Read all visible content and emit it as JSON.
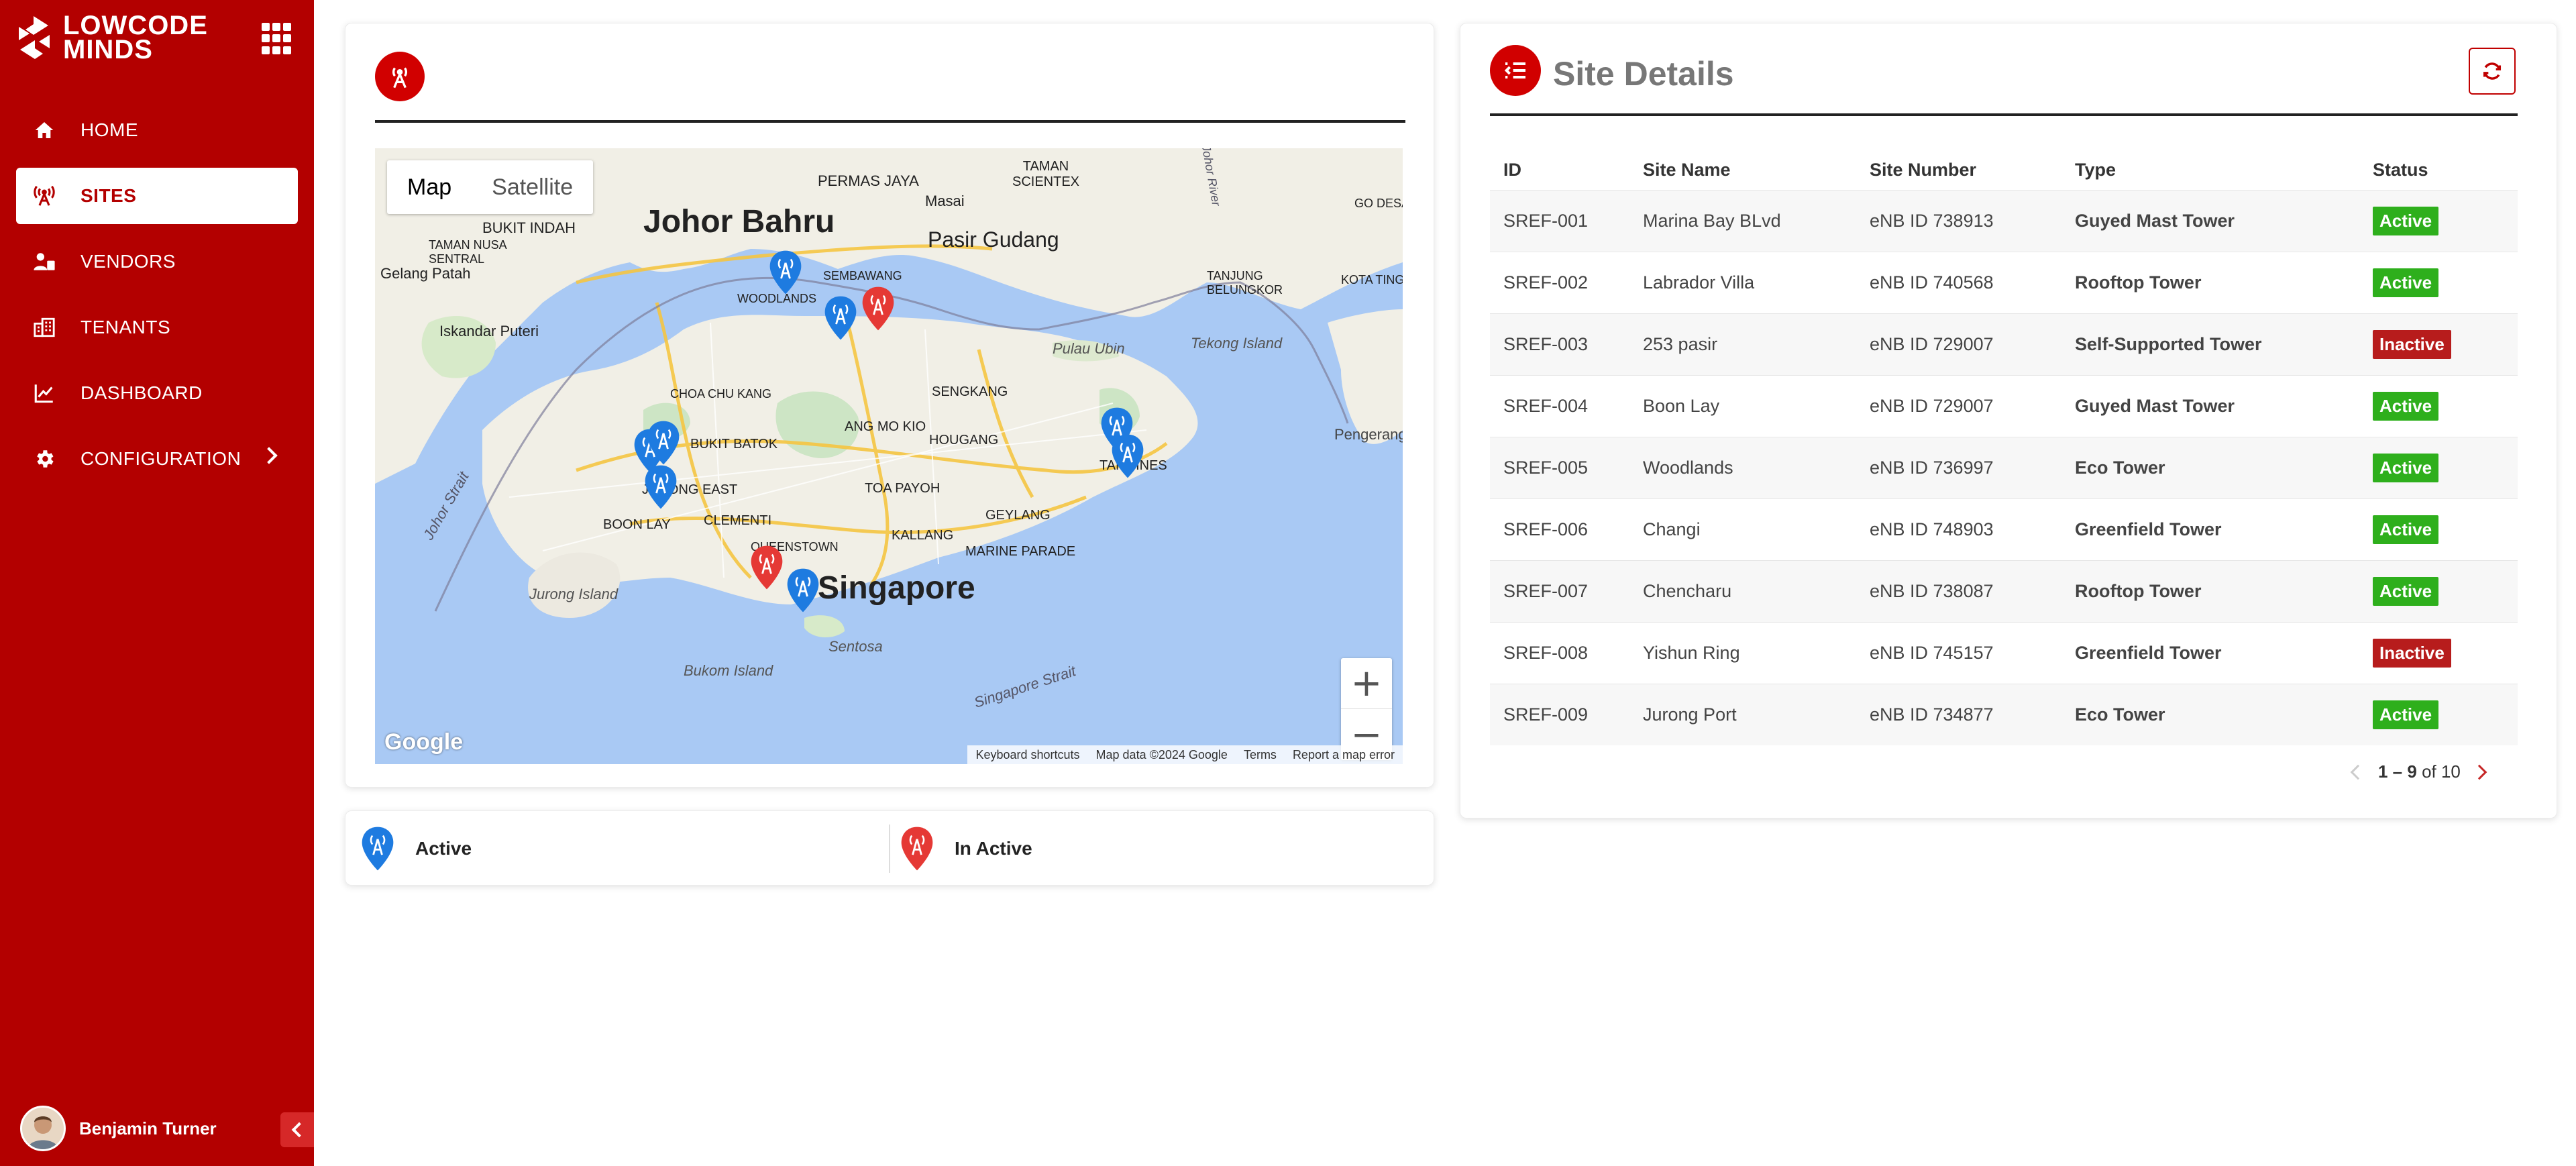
{
  "brand": {
    "name": "LOWCODE MINDS"
  },
  "sidebar": {
    "items": [
      {
        "label": "HOME",
        "icon": "home-icon"
      },
      {
        "label": "SITES",
        "icon": "antenna-icon",
        "active": true
      },
      {
        "label": "VENDORS",
        "icon": "vendor-icon"
      },
      {
        "label": "TENANTS",
        "icon": "building-icon"
      },
      {
        "label": "DASHBOARD",
        "icon": "chart-icon"
      },
      {
        "label": "CONFIGURATION",
        "icon": "gear-icon"
      }
    ],
    "user": {
      "name": "Benjamin Turner"
    }
  },
  "map": {
    "tabs": [
      "Map",
      "Satellite"
    ],
    "zoom_in": "+",
    "zoom_out": "−",
    "logo": "Google",
    "footer": [
      "Keyboard shortcuts",
      "Map data ©2024 Google",
      "Terms",
      "Report a map error"
    ],
    "labels": {
      "johor_bahru": "Johor Bahru",
      "singapore": "Singapore",
      "pasir_gudang": "Pasir Gudang",
      "jurong_island": "Jurong Island",
      "bukom_island": "Bukom Island",
      "sentosa": "Sentosa",
      "pulau_ubin": "Pulau Ubin",
      "tekong_island": "Tekong Island",
      "pengerang": "Pengerang",
      "iskandar_puteri": "Iskandar Puteri",
      "gelang_patah": "Gelang Patah",
      "bukit_indah": "BUKIT INDAH",
      "permas_jaya": "PERMAS JAYA",
      "masai": "Masai",
      "taman_scientex": "TAMAN SCIENTEX",
      "taman_nusa_sentral": "TAMAN NUSA SENTRAL",
      "sembawang": "SEMBAWANG",
      "woodlands": "WOODLANDS",
      "choa_chu_kang": "CHOA CHU KANG",
      "bukit_batok": "BUKIT BATOK",
      "ang_mo_kio": "ANG MO KIO",
      "sengkang": "SENGKANG",
      "hougang": "HOUGANG",
      "toa_payoh": "TOA PAYOH",
      "tampines": "TAMPINES",
      "geylang": "GEYLANG",
      "kallang": "KALLANG",
      "marine_parade": "MARINE PARADE",
      "queenstown": "QUEENSTOWN",
      "clementi": "CLEMENTI",
      "jurong_east": "JURONG EAST",
      "boon_lay": "BOON LAY",
      "johor_strait": "Johor Strait",
      "singapore_strait": "Singapore Strait",
      "tanjung_belungkor": "TANJUNG BELUNGKOR",
      "kota_tinggi": "KOTA TINGGI",
      "johor_river": "Johor River",
      "go_desa": "GO DESA"
    }
  },
  "legend": {
    "active": "Active",
    "inactive": "In Active",
    "active_color": "#1e7be0",
    "inactive_color": "#e53935"
  },
  "details": {
    "title": "Site Details",
    "columns": [
      "ID",
      "Site Name",
      "Site Number",
      "Type",
      "Status"
    ],
    "rows": [
      {
        "id": "SREF-001",
        "name": "Marina Bay BLvd",
        "number": "eNB ID 738913",
        "type": "Guyed Mast Tower",
        "status": "Active",
        "link": true
      },
      {
        "id": "SREF-002",
        "name": "Labrador Villa",
        "number": "eNB ID 740568",
        "type": "Rooftop Tower",
        "status": "Active",
        "link": true
      },
      {
        "id": "SREF-003",
        "name": "253 pasir",
        "number": "eNB ID 729007",
        "type": "Self-Supported Tower",
        "status": "Inactive",
        "link": true
      },
      {
        "id": "SREF-004",
        "name": "Boon Lay",
        "number": "eNB ID 729007",
        "type": "Guyed Mast Tower",
        "status": "Active",
        "link": true
      },
      {
        "id": "SREF-005",
        "name": "Woodlands",
        "number": "eNB ID 736997",
        "type": "Eco Tower",
        "status": "Active",
        "link": false
      },
      {
        "id": "SREF-006",
        "name": "Changi",
        "number": "eNB ID 748903",
        "type": "Greenfield Tower",
        "status": "Active",
        "link": true
      },
      {
        "id": "SREF-007",
        "name": "Chencharu",
        "number": "eNB ID 738087",
        "type": "Rooftop Tower",
        "status": "Active",
        "link": true
      },
      {
        "id": "SREF-008",
        "name": "Yishun Ring",
        "number": "eNB ID 745157",
        "type": "Greenfield Tower",
        "status": "Inactive",
        "link": false
      },
      {
        "id": "SREF-009",
        "name": "Jurong Port",
        "number": "eNB ID 734877",
        "type": "Eco Tower",
        "status": "Active",
        "link": true
      }
    ],
    "pagination": {
      "range": "1 – 9",
      "of": "of 10"
    }
  },
  "colors": {
    "brand_red": "#b30000",
    "active_green": "#2eaf1c",
    "inactive_red": "#b71c1c"
  }
}
